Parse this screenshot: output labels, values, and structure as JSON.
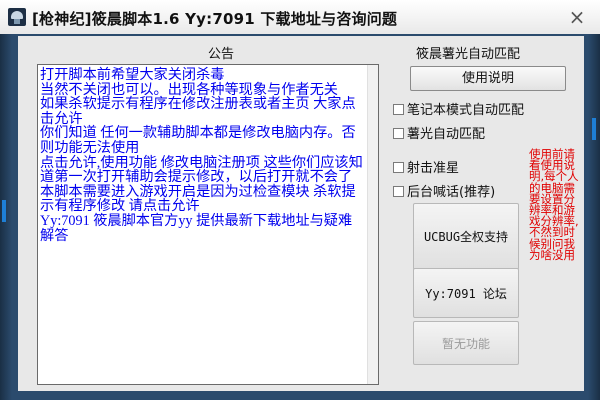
{
  "window": {
    "title": "[枪神纪]筱晨脚本1.6 Yy:7091 下载地址与咨询问题",
    "close_glyph": "×"
  },
  "notice": {
    "title": "公告",
    "text": "打开脚本前希望大家关闭杀毒\n当然不关闭也可以。出现各种等现象与作者无关\n如果杀软提示有程序在修改注册表或者主页 大家点击允许\n你们知道 任何一款辅助脚本都是修改电脑内存。否则功能无法使用\n点击允许,使用功能 修改电脑注册项 这些你们应该知道第一次打开辅助会提示修改，以后打开就不会了\n本脚本需要进入游戏开启是因为过检查模块 杀软提示有程序修改 请点击允许\nYy:7091 筱晨脚本官方yy 提供最新下载地址与疑难解答"
  },
  "panel": {
    "title": "筱晨薯光自动匹配",
    "usage_button": "使用说明",
    "checkboxes": [
      "笔记本模式自动匹配",
      "薯光自动匹配",
      "射击准星",
      "后台喊话(推荐)"
    ],
    "buttons": [
      "UCBUG全权支持",
      "Yy:7091 论坛",
      "暂无功能"
    ],
    "red_note": "使用前请看使用说明,每个人的电脑需要设置分辨率和游戏分辨率,不然到时候别问我为啥没用"
  },
  "colors": {
    "notice_text": "#0000ee",
    "red_note": "#e00000",
    "frame": "#2b4b6d"
  }
}
